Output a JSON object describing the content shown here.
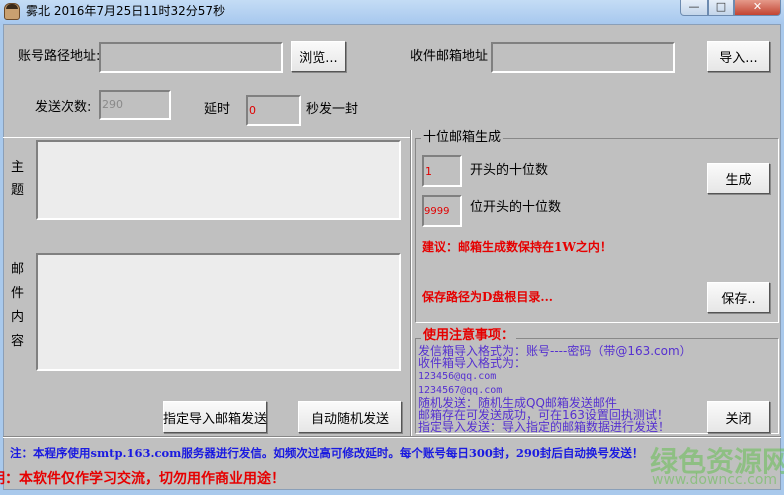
{
  "window": {
    "title": "雾北  2016年7月25日11时32分57秒",
    "minimize": "—",
    "maximize": "□",
    "close": "✕"
  },
  "top": {
    "account_path_label": "账号路径地址:",
    "account_path_value": "",
    "browse_button": "浏览...",
    "recipient_label": "收件邮箱地址",
    "recipient_value": "",
    "import_button": "导入...",
    "send_count_label": "发送次数:",
    "send_count_value": "290",
    "delay_label": "延时",
    "delay_value": "0",
    "delay_suffix": "秒发一封"
  },
  "compose": {
    "subject_label": [
      "主",
      "题"
    ],
    "subject_value": "",
    "body_label": [
      "邮",
      "件",
      "内",
      "容"
    ],
    "body_value": "",
    "send_imported_button": "指定导入邮箱发送",
    "send_random_button": "自动随机发送"
  },
  "generator": {
    "title": "十位邮箱生成",
    "start_value": "1",
    "start_label": "开头的十位数",
    "digits_value": "9999",
    "digits_label": "位开头的十位数",
    "generate_button": "生成",
    "advice": "建议：邮箱生成数保持在1W之内！",
    "save_path_note": "保存路径为D盘根目录...",
    "save_button": "保存.."
  },
  "notes": {
    "title": "使用注意事项：",
    "lines": [
      "发信箱导入格式为：账号----密码（带@163.com）",
      "收件箱导入格式为：",
      "123456@qq.com",
      "1234567@qq.com",
      "随机发送：随机生成QQ邮箱发送邮件",
      "邮箱存在可发送成功，可在163设置回执测试！",
      "指定导入发送：导入指定的邮箱数据进行发送！"
    ],
    "close_button": "关闭"
  },
  "footer": {
    "info": "注：本程序使用smtp.163.com服务器进行发信。如频次过高可修改延时。每个账号每日300封，290封后自动换号发送！",
    "disclaimer": "明：本软件仅作学习交流，切勿用作商业用途！"
  },
  "watermark": {
    "name": "绿色资源网",
    "url": "www.downcc.com"
  },
  "colors": {
    "panel": "#c0c0c0",
    "warning": "#e60000",
    "notes": "#5530d0",
    "info": "#1a1ae0"
  }
}
